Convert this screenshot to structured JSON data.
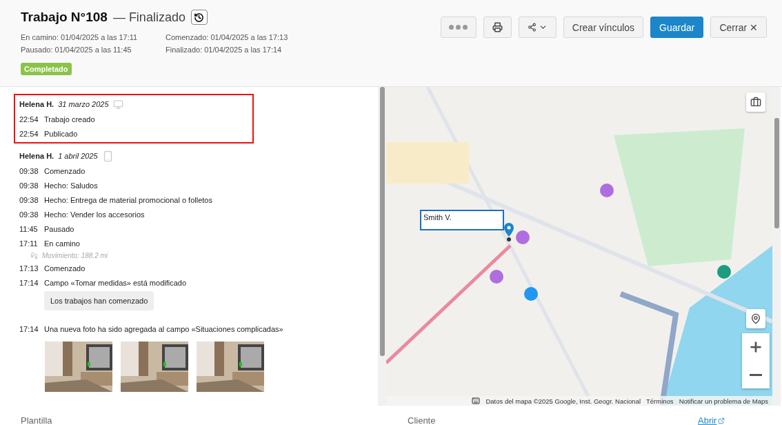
{
  "header": {
    "title": "Trabajo N°108",
    "status": "— Finalizado",
    "dates": [
      {
        "text": "En camino: 01/04/2025 a las 17:11"
      },
      {
        "text": "Comenzado: 01/04/2025 a las 17:13"
      },
      {
        "text": "Pausado: 01/04/2025 a las 11:45"
      },
      {
        "text": "Finalizado: 01/04/2025 a las 17:14"
      }
    ],
    "badge": "Completado",
    "buttons": [
      {
        "kind": "more"
      },
      {
        "kind": "print"
      },
      {
        "kind": "share"
      },
      {
        "kind": "text",
        "label": "Crear vínculos"
      },
      {
        "kind": "primary",
        "label": "Guardar"
      },
      {
        "kind": "close",
        "label": "Cerrar ✕"
      }
    ]
  },
  "timeline": [
    {
      "author": "Helena H.",
      "date": "31 marzo 2025",
      "kind": "desktop",
      "highlighted": true,
      "entries": [
        {
          "kind": "event",
          "time": "22:54",
          "text": "Trabajo creado"
        },
        {
          "kind": "event",
          "time": "22:54",
          "text": "Publicado"
        }
      ]
    },
    {
      "author": "Helena H.",
      "date": "1 abril 2025",
      "kind": "mobile",
      "highlighted": false,
      "entries": [
        {
          "kind": "event",
          "time": "09:38",
          "text": "Comenzado"
        },
        {
          "kind": "event",
          "time": "09:38",
          "text": "Hecho: Saludos"
        },
        {
          "kind": "event",
          "time": "09:38",
          "text": "Hecho: Entrega de material promocional o folletos"
        },
        {
          "kind": "event",
          "time": "09:38",
          "text": "Hecho: Vender los accesorios"
        },
        {
          "kind": "event",
          "time": "11:45",
          "text": "Pausado"
        },
        {
          "kind": "event",
          "time": "17:11",
          "text": "En camino"
        },
        {
          "kind": "movement",
          "text": "Movimiento: 188.2 mi"
        },
        {
          "kind": "event",
          "time": "17:13",
          "text": "Comenzado"
        },
        {
          "kind": "event",
          "time": "17:14",
          "text": "Campo «Tomar medidas» está modificado"
        },
        {
          "kind": "note",
          "text": "Los trabajos han comenzado"
        },
        {
          "kind": "event",
          "time": "17:14",
          "text": "Una nueva foto ha sido agregada al campo «Situaciones complicadas»"
        },
        {
          "kind": "photos"
        }
      ]
    }
  ],
  "map": {
    "marker_label": "Smith V.",
    "attribution": [
      {
        "text": "Datos del mapa ©2025 Google, Inst. Geogr. Nacional"
      },
      {
        "text": "Términos"
      },
      {
        "text": "Notificar un problema de Maps"
      }
    ]
  },
  "footer": {
    "left_label": "Plantilla",
    "right_label": "Cliente",
    "link": "Abrir"
  }
}
